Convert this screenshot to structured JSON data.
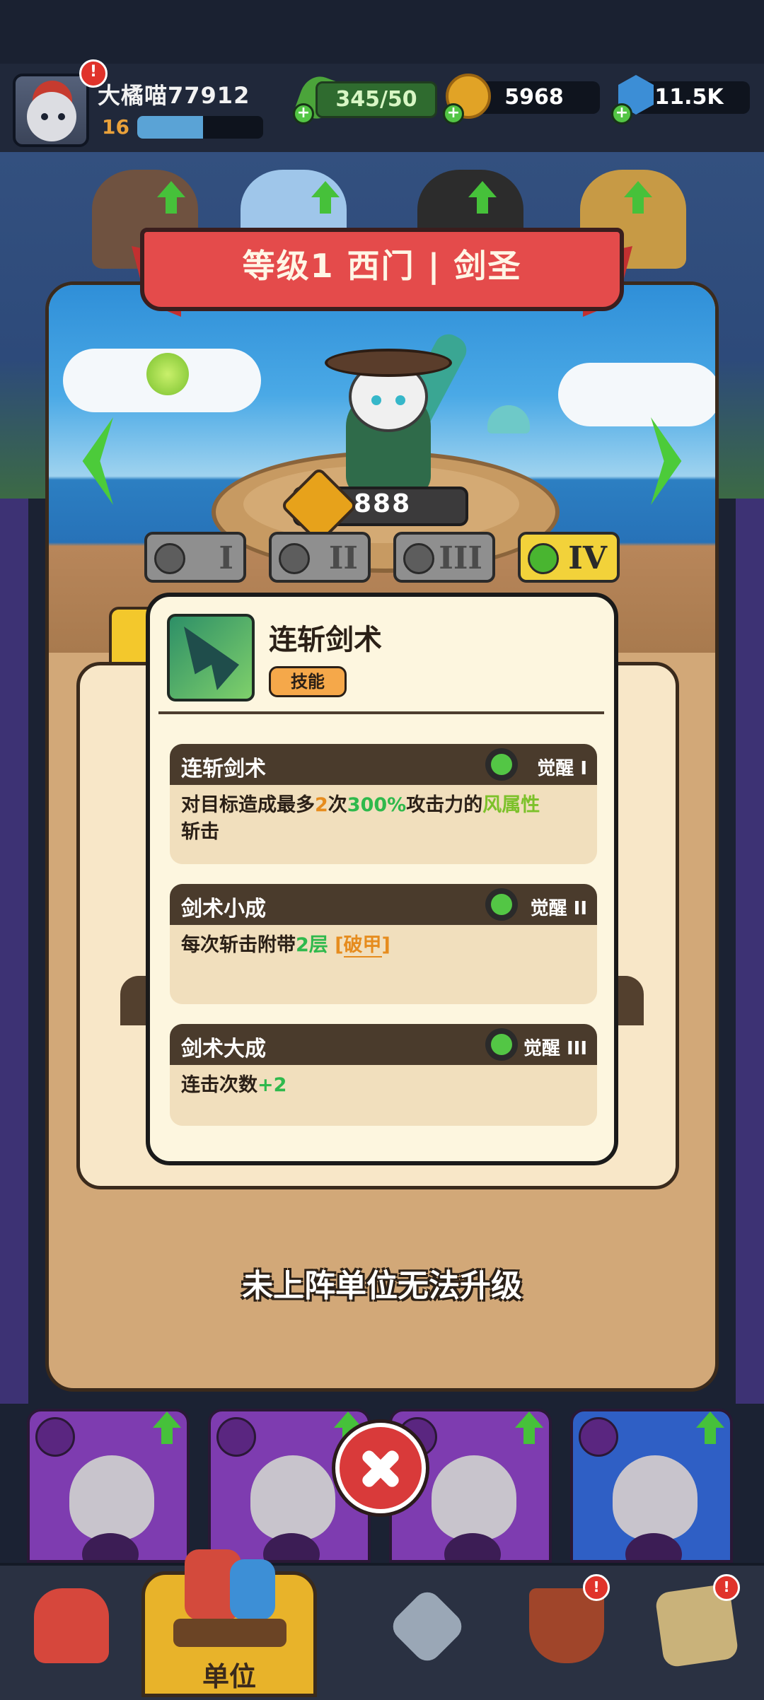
{
  "player": {
    "name": "大橘喵77912",
    "level": "16",
    "xp_fraction": 0.52,
    "has_alert": true,
    "alert_symbol": "!"
  },
  "resources": {
    "energy": "345/50",
    "coins": "5968",
    "gems": "11.5K",
    "add_symbol": "+"
  },
  "unit_view": {
    "title": "等级1 西门 | 剑圣",
    "power": "888",
    "awakening_tabs": [
      {
        "label": "I",
        "active": false
      },
      {
        "label": "II",
        "active": false
      },
      {
        "label": "III",
        "active": false
      },
      {
        "label": "IV",
        "active": true
      }
    ],
    "cannot_upgrade_text": "未上阵单位无法升级"
  },
  "skill_popup": {
    "name": "连斩剑术",
    "tag": "技能",
    "awakenings": [
      {
        "title": "连斩剑术",
        "level": "觉醒 I",
        "desc_parts": [
          "对目标造成最多",
          "2",
          "次",
          "300%",
          "攻击力的",
          "风属性",
          "斩击"
        ]
      },
      {
        "title": "剑术小成",
        "level": "觉醒 II",
        "desc_parts": [
          "每次斩击附带",
          "2层",
          " [",
          "破甲",
          "]"
        ]
      },
      {
        "title": "剑术大成",
        "level": "觉醒 III",
        "desc_parts": [
          "连击次数",
          "+2"
        ]
      }
    ]
  },
  "navbar": {
    "items": [
      {
        "name": "home",
        "icon": "house-icon",
        "alert": false
      },
      {
        "name": "units",
        "label": "单位",
        "icon": "unit-cats-icon",
        "active": true
      },
      {
        "name": "battle",
        "icon": "crossed-swords-icon",
        "alert": false
      },
      {
        "name": "ship",
        "icon": "ship-icon",
        "alert": true
      },
      {
        "name": "map",
        "icon": "map-icon",
        "alert": true
      }
    ],
    "alert_symbol": "!"
  },
  "colors": {
    "accent_green": "#4ccb3a",
    "ribbon_red": "#e44b4b",
    "active_tab_yellow": "#f2d23a",
    "highlight_orange": "#e68c1e",
    "highlight_green": "#2fb94c"
  }
}
